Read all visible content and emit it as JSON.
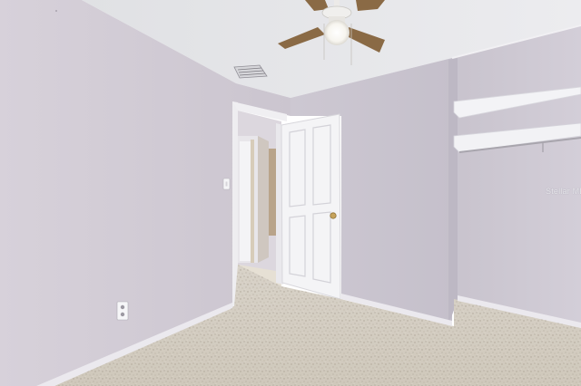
{
  "scene": {
    "description_free": true,
    "watermark_text": "Stellar MLS",
    "colors": {
      "ceiling": "#e4e5e8",
      "wall_left": "#d2ccd5",
      "wall_back": "#c9c4cf",
      "closet_wall": "#cdc8d2",
      "floor": "#d9d2c6",
      "trim": "#eeedf0",
      "door": "#f3f3f5"
    },
    "icons": [
      "ceiling-fan-icon",
      "air-vent-icon",
      "light-switch-icon",
      "power-outlet-icon",
      "door-knob-icon"
    ]
  }
}
